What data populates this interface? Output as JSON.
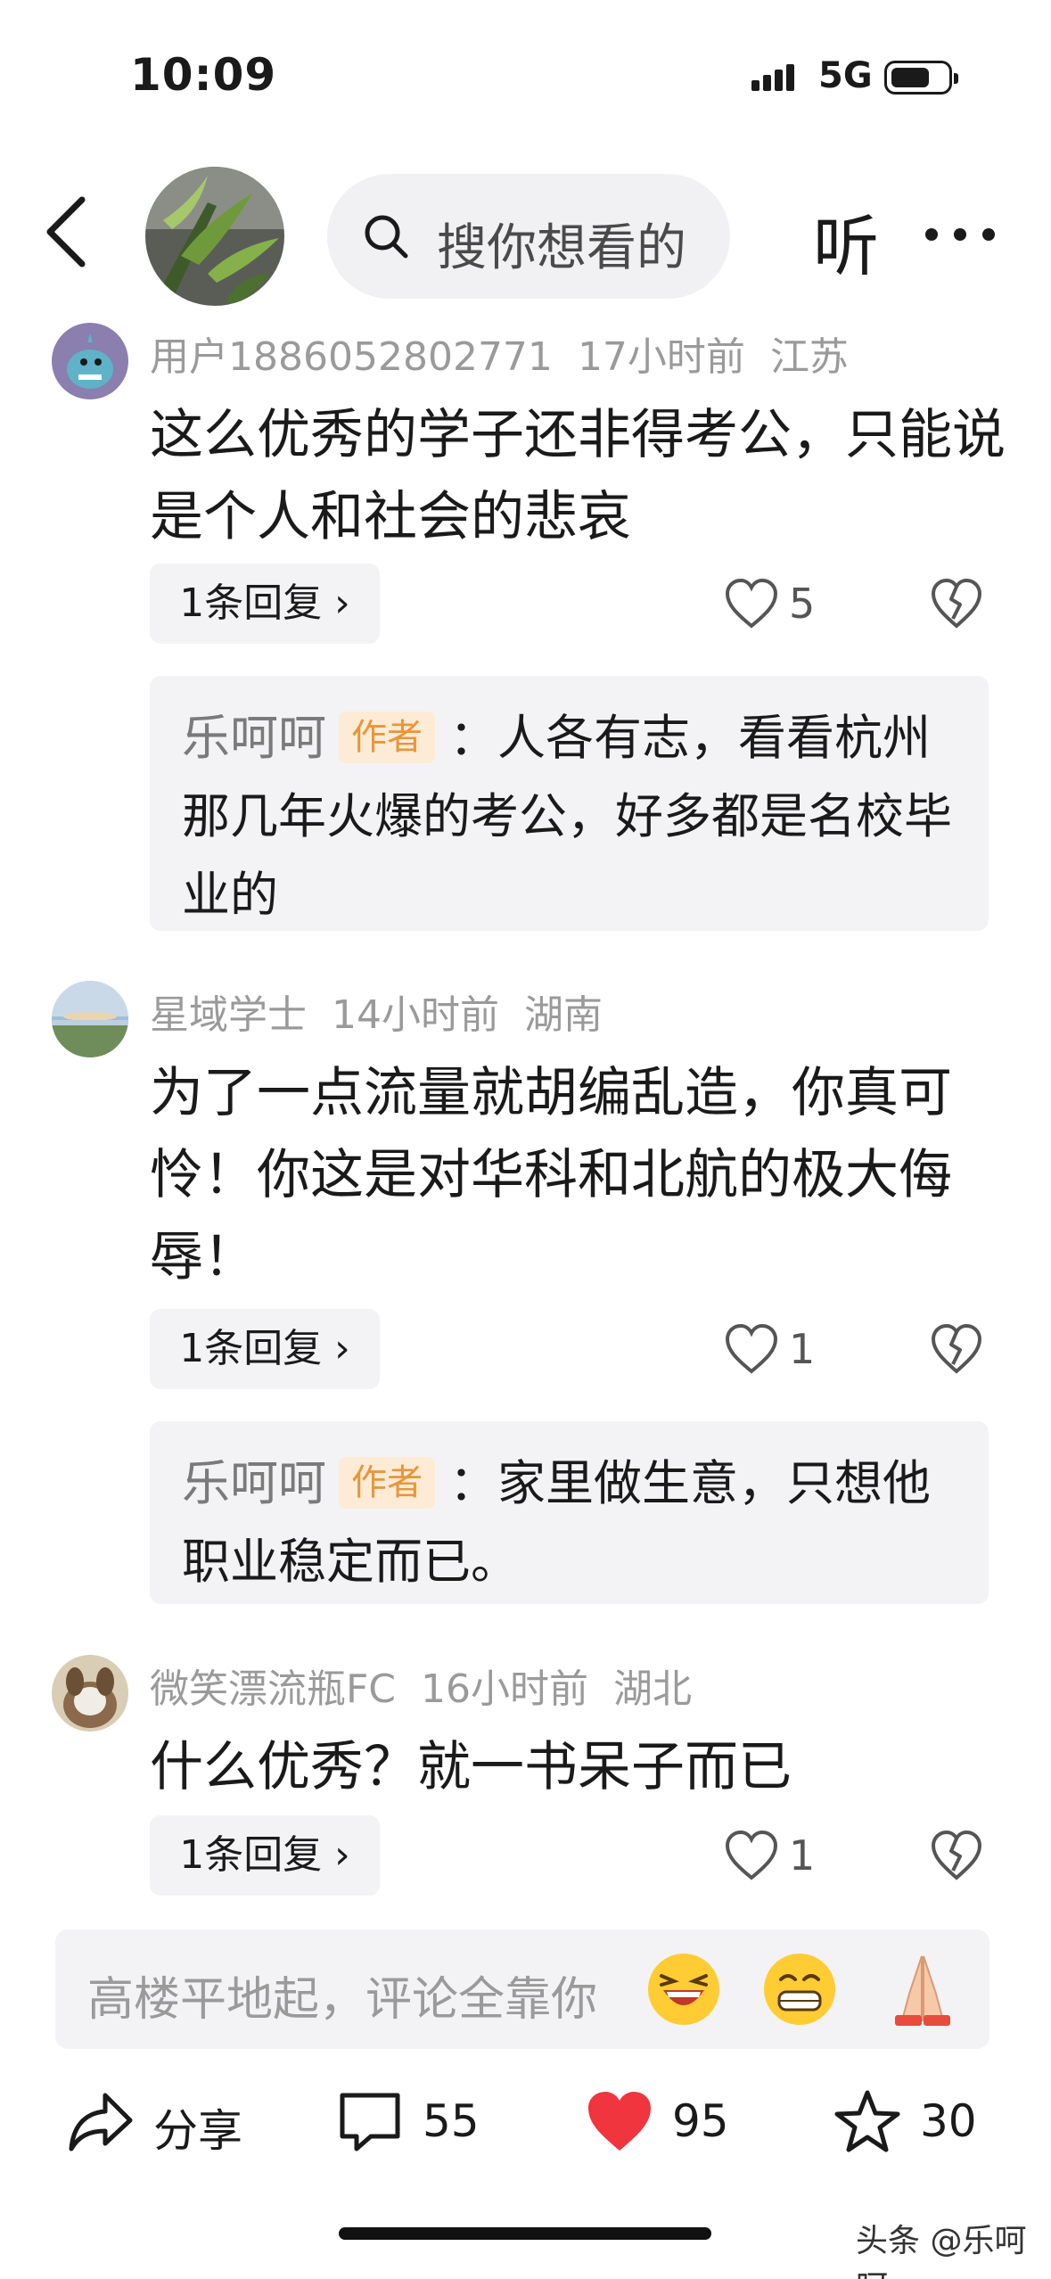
{
  "status_bar": {
    "time": "10:09",
    "network": "5G"
  },
  "header": {
    "search_placeholder": "搜你想看的",
    "listen_label": "听"
  },
  "comments": [
    {
      "user": "用户1886052802771",
      "time": "17小时前",
      "location": "江苏",
      "text": "这么优秀的学子还非得考公，只能说是个人和社会的悲哀",
      "reply_label": "1条回复 ›",
      "likes": "5",
      "author_reply": {
        "name": "乐呵呵",
        "badge": "作者",
        "text": "：人各有志，看看杭州那几年火爆的考公，好多都是名校毕业的"
      }
    },
    {
      "user": "星域学士",
      "time": "14小时前",
      "location": "湖南",
      "text": "为了一点流量就胡编乱造，你真可怜！你这是对华科和北航的极大侮辱！",
      "reply_label": "1条回复 ›",
      "likes": "1",
      "author_reply": {
        "name": "乐呵呵",
        "badge": "作者",
        "text": "：家里做生意，只想他职业稳定而已。"
      }
    },
    {
      "user": "微笑漂流瓶FC",
      "time": "16小时前",
      "location": "湖北",
      "text": "什么优秀？就一书呆子而已",
      "reply_label": "1条回复 ›",
      "likes": "1"
    }
  ],
  "comment_input": {
    "placeholder": "高楼平地起，评论全靠你"
  },
  "actions": {
    "share_label": "分享",
    "comments_count": "55",
    "likes_count": "95",
    "favorites_count": "30"
  },
  "watermark": "头条 @乐呵呵",
  "colors": {
    "author_badge": "#e8963a",
    "like_red": "#f0353f",
    "meta_gray": "#9a9a9a"
  }
}
